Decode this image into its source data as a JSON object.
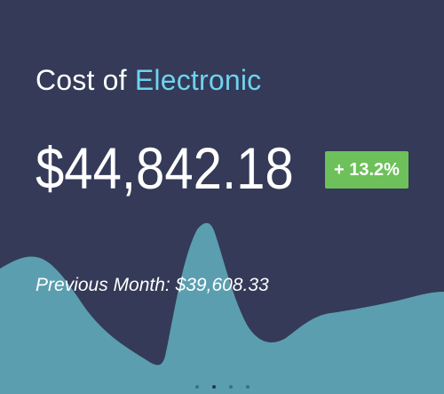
{
  "header": {
    "title_prefix": "Cost of ",
    "title_highlight": "Electronic"
  },
  "metric": {
    "amount": "$44,842.18",
    "change": "+ 13.2%",
    "previous": "Previous Month: $39,608.33"
  },
  "pagination": {
    "total": 4,
    "active_index": 1
  },
  "colors": {
    "background": "#343a57",
    "wave": "#5b9eaf",
    "accent_text": "#6fd2f0",
    "badge": "#6ec05a"
  }
}
